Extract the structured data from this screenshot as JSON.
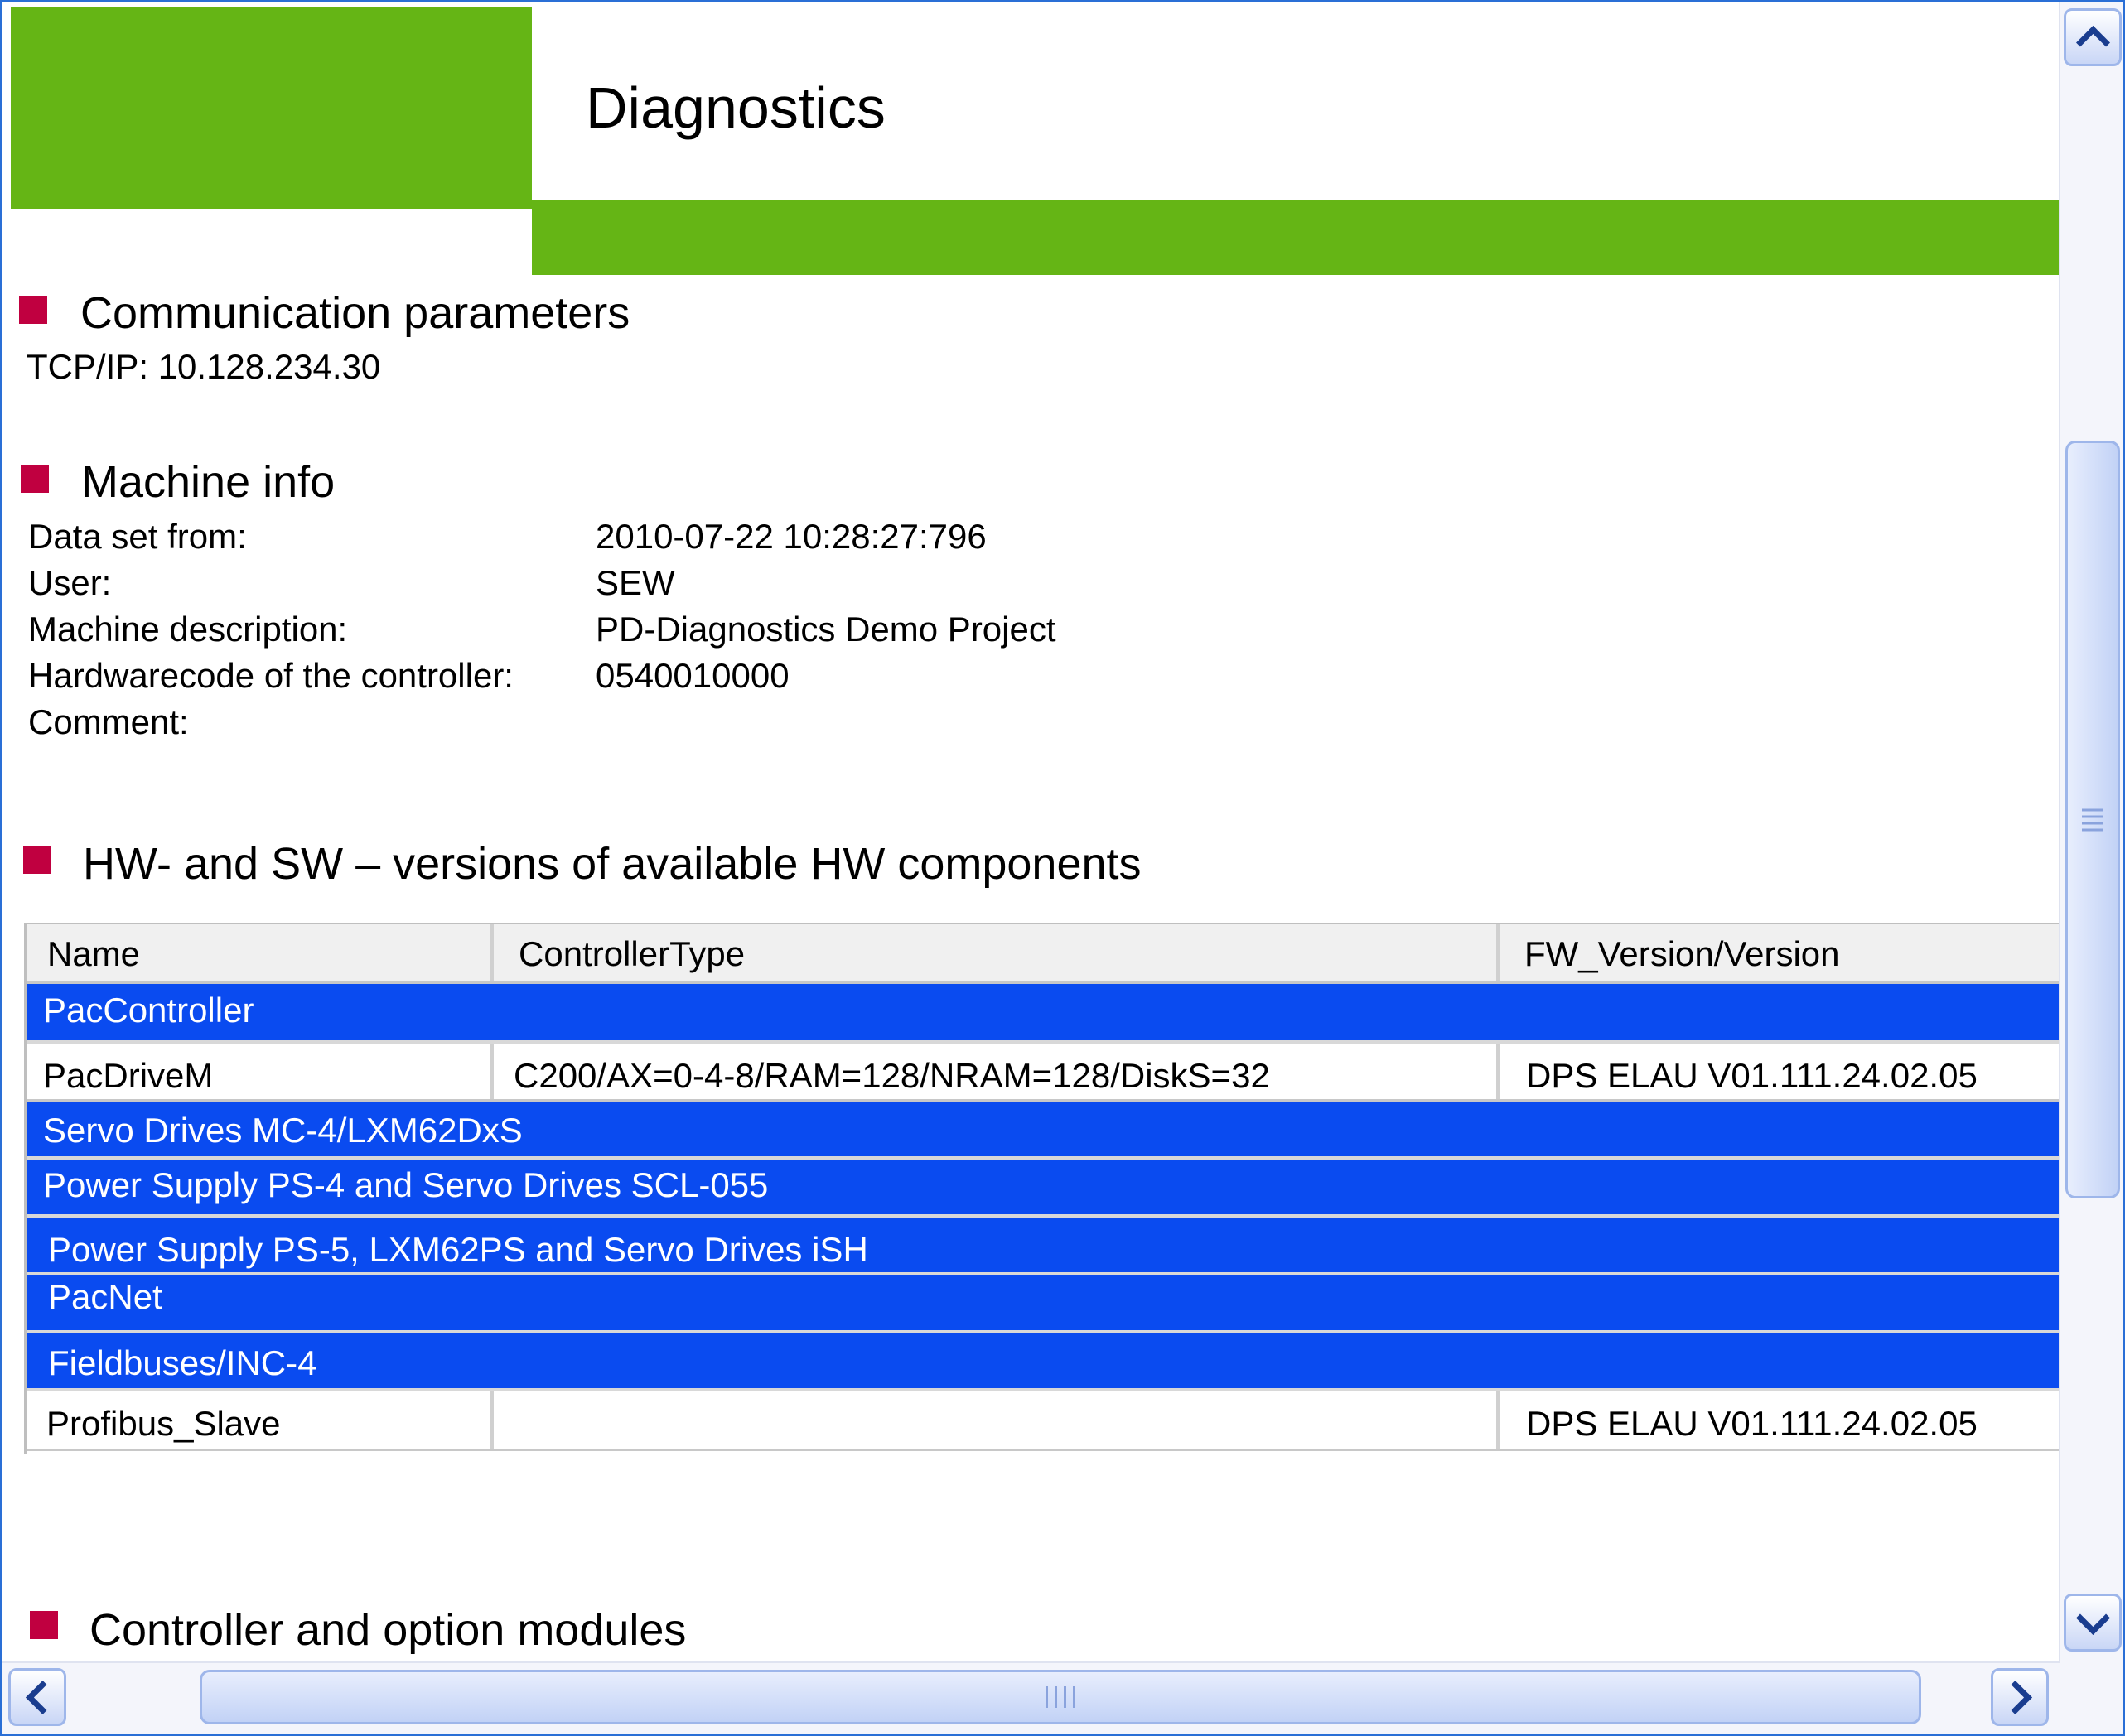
{
  "page": {
    "title": "Diagnostics"
  },
  "colors": {
    "header_green": "#65b515",
    "bullet_red": "#c00040",
    "group_row_blue": "#0a4bf0"
  },
  "communication": {
    "heading": "Communication parameters",
    "tcpip": "TCP/IP: 10.128.234.30"
  },
  "machine_info": {
    "heading": "Machine info",
    "rows": [
      {
        "label": "Data set from:",
        "value": "2010-07-22 10:28:27:796"
      },
      {
        "label": "User:",
        "value": "SEW"
      },
      {
        "label": "Machine description:",
        "value": "PD-Diagnostics Demo Project"
      },
      {
        "label": "Hardwarecode of the controller:",
        "value": "0540010000"
      },
      {
        "label": "Comment:",
        "value": ""
      }
    ]
  },
  "hw_sw": {
    "heading": "HW- and SW – versions of available HW components",
    "columns": [
      "Name",
      "ControllerType",
      "FW_Version/Version"
    ],
    "rows": [
      {
        "type": "group",
        "label": "PacController"
      },
      {
        "type": "data",
        "name": "PacDriveM",
        "controller_type": "C200/AX=0-4-8/RAM=128/NRAM=128/DiskS=32",
        "version": "DPS ELAU V01.111.24.02.05"
      },
      {
        "type": "group",
        "label": "Servo Drives MC-4/LXM62DxS"
      },
      {
        "type": "group",
        "label": "Power Supply PS-4 and Servo Drives SCL-055"
      },
      {
        "type": "group",
        "label": "Power Supply PS-5, LXM62PS and Servo Drives iSH"
      },
      {
        "type": "group",
        "label": "PacNet"
      },
      {
        "type": "group",
        "label": "Fieldbuses/INC-4"
      },
      {
        "type": "data",
        "name": "Profibus_Slave",
        "controller_type": "",
        "version": "DPS ELAU V01.111.24.02.05"
      }
    ]
  },
  "controller_modules": {
    "heading": "Controller and option modules"
  },
  "scrollbars": {
    "vertical_position": 0.37,
    "horizontal_position": 0.5
  }
}
